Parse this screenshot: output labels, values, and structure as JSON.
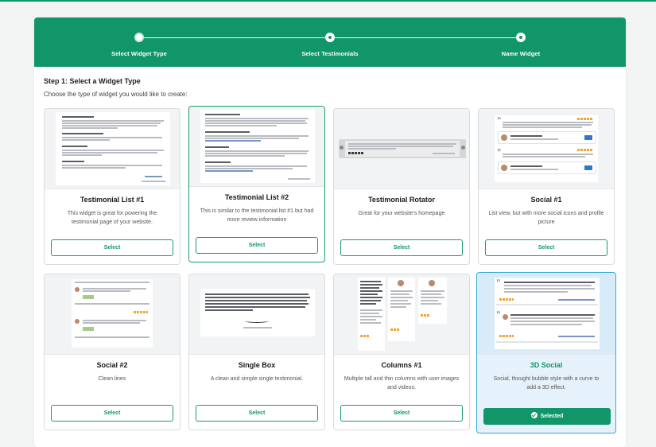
{
  "wizard": {
    "steps": [
      {
        "label": "Select Widget Type",
        "state": "active"
      },
      {
        "label": "Select Testimonials",
        "state": "inactive"
      },
      {
        "label": "Name Widget",
        "state": "inactive"
      }
    ]
  },
  "step_heading": "Step 1: Select a Widget Type",
  "step_subheading": "Choose the type of widget you would like to create:",
  "cards": [
    {
      "title": "Testimonial List #1",
      "description": "This widget is great for powering the testimonial page of your website.",
      "button": "Select"
    },
    {
      "title": "Testimonial List #2",
      "description": "This is similar to the testimonial list #1 but had more review information",
      "button": "Select"
    },
    {
      "title": "Testimonial Rotator",
      "description": "Great for your website's homepage",
      "button": "Select"
    },
    {
      "title": "Social #1",
      "description": "List view, but with more social icons and profile picture",
      "button": "Select"
    },
    {
      "title": "Social #2",
      "description": "Clean lines",
      "button": "Select"
    },
    {
      "title": "Single Box",
      "description": "A clean and simple single testimonial.",
      "button": "Select"
    },
    {
      "title": "Columns #1",
      "description": "Multiple tall and thin columns with user images and videos.",
      "button": "Select"
    },
    {
      "title": "3D Social",
      "description": "Social, thought bubble style with a curve to add a 3D effect.",
      "button": "Selected",
      "selected": true
    }
  ],
  "colors": {
    "brand_green": "#11966a",
    "selected_border": "#35a8d8",
    "selected_bg": "#e6f2fb"
  },
  "icons": {
    "selected_button_icon": "check-circle-icon"
  }
}
